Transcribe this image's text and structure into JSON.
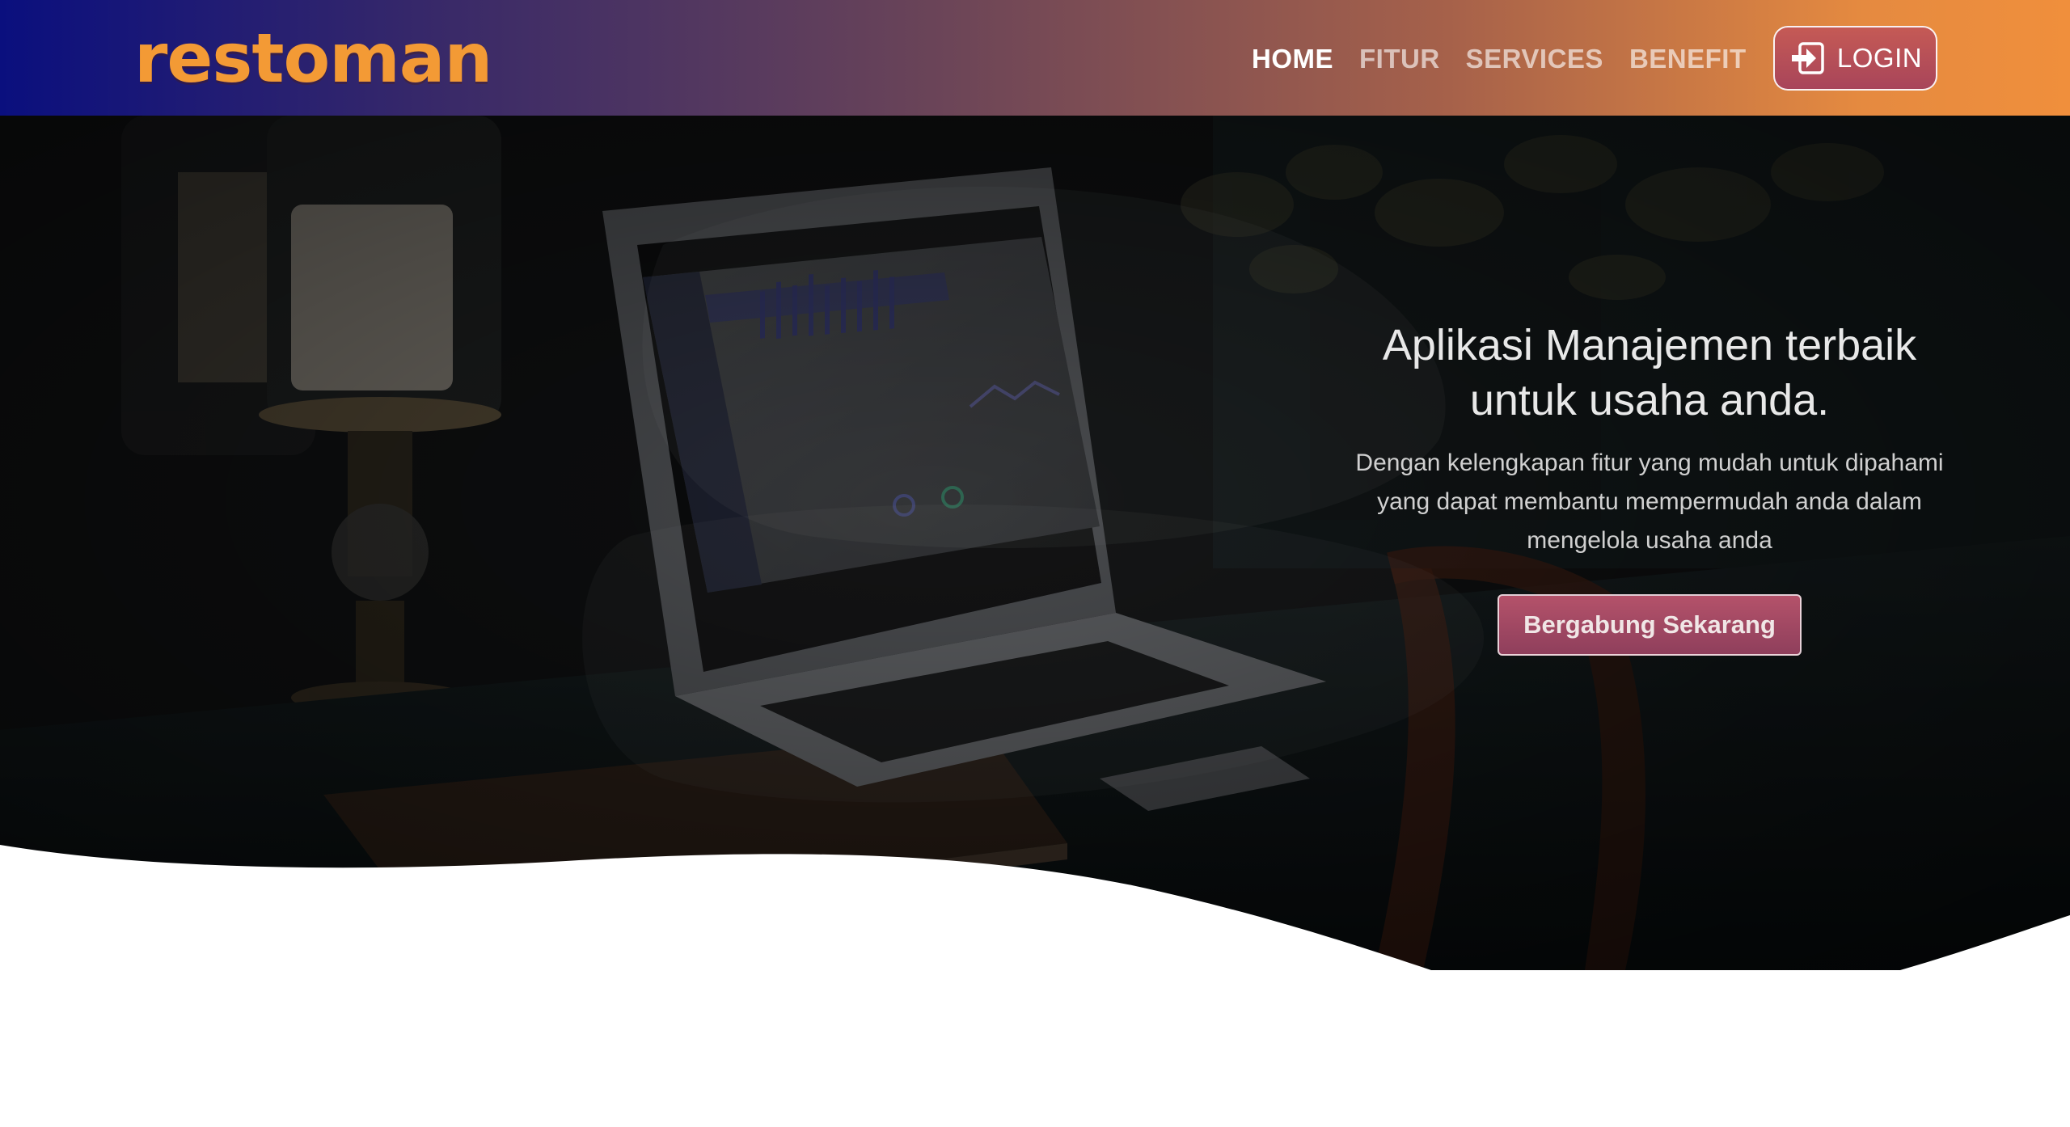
{
  "brand": {
    "name": "restoman"
  },
  "nav": {
    "items": [
      {
        "label": "HOME",
        "active": true
      },
      {
        "label": "FITUR",
        "active": false
      },
      {
        "label": "SERVICES",
        "active": false
      },
      {
        "label": "BENEFIT",
        "active": false
      }
    ],
    "login_label": "LOGIN",
    "login_icon": "login-icon"
  },
  "hero": {
    "title_line1": "Aplikasi Manajemen terbaik",
    "title_line2": "untuk usaha anda.",
    "subtitle_line1": "Dengan kelengkapan fitur yang mudah untuk dipahami",
    "subtitle_line2": "yang dapat membantu mempermudah anda dalam",
    "subtitle_line3": "mengelola usaha anda",
    "cta_label": "Bergabung Sekarang"
  },
  "colors": {
    "brand_orange": "#f39a35",
    "nav_gradient_start": "#0a0f7e",
    "nav_gradient_end": "#f08f3c",
    "cta": "#a44a63"
  }
}
